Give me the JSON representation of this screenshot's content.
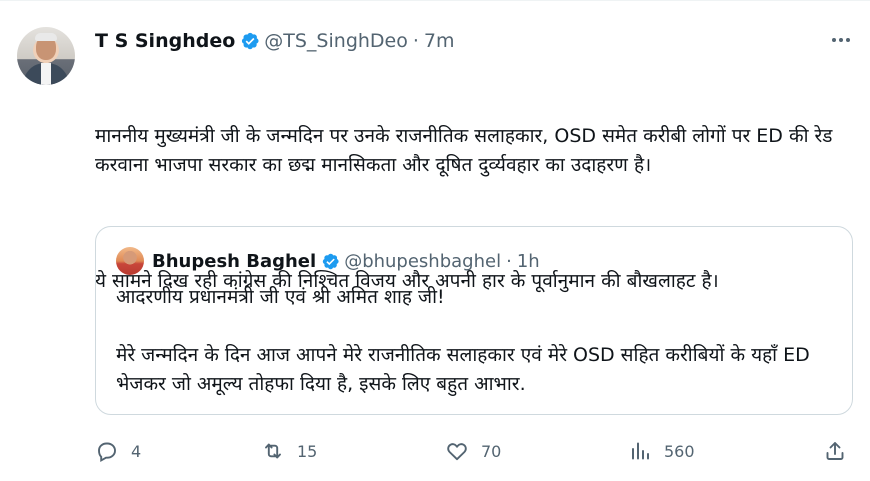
{
  "tweet": {
    "author_name": "T S Singhdeo",
    "handle": "@TS_SinghDeo",
    "separator": "·",
    "time": "7m",
    "text_paragraphs": [
      "माननीय मुख्यमंत्री जी के जन्मदिन पर उनके राजनीतिक सलाहकार, OSD समेत करीबी लोगों पर ED की रेड करवाना भाजपा सरकार का छद्म मानसिकता और दूषित दुर्व्यवहार का उदाहरण है।",
      "ये सामने दिख रही कांग्रेस की निश्चित विजय और अपनी हार के पूर्वानुमान की बौखलाहट है।"
    ]
  },
  "quoted_tweet": {
    "author_name": "Bhupesh Baghel",
    "handle": "@bhupeshbaghel",
    "separator": "·",
    "time": "1h",
    "text_paragraphs": [
      "आदरणीय प्रधानमंत्री जी एवं श्री अमित शाह जी!",
      "मेरे जन्मदिन के दिन आज आपने मेरे राजनीतिक सलाहकार एवं मेरे OSD सहित करीबियों के यहाँ ED भेजकर जो अमूल्य तोहफा दिया है, इसके लिए बहुत आभार."
    ]
  },
  "actions": {
    "replies": "4",
    "retweets": "15",
    "likes": "70",
    "views": "560"
  },
  "icons": [
    "verified-badge-icon",
    "more-options-icon",
    "reply-icon",
    "retweet-icon",
    "like-icon",
    "views-icon",
    "share-icon"
  ],
  "colors": {
    "verified": "#1d9bf0",
    "secondary_text": "#536471",
    "border": "#cfd9de"
  }
}
